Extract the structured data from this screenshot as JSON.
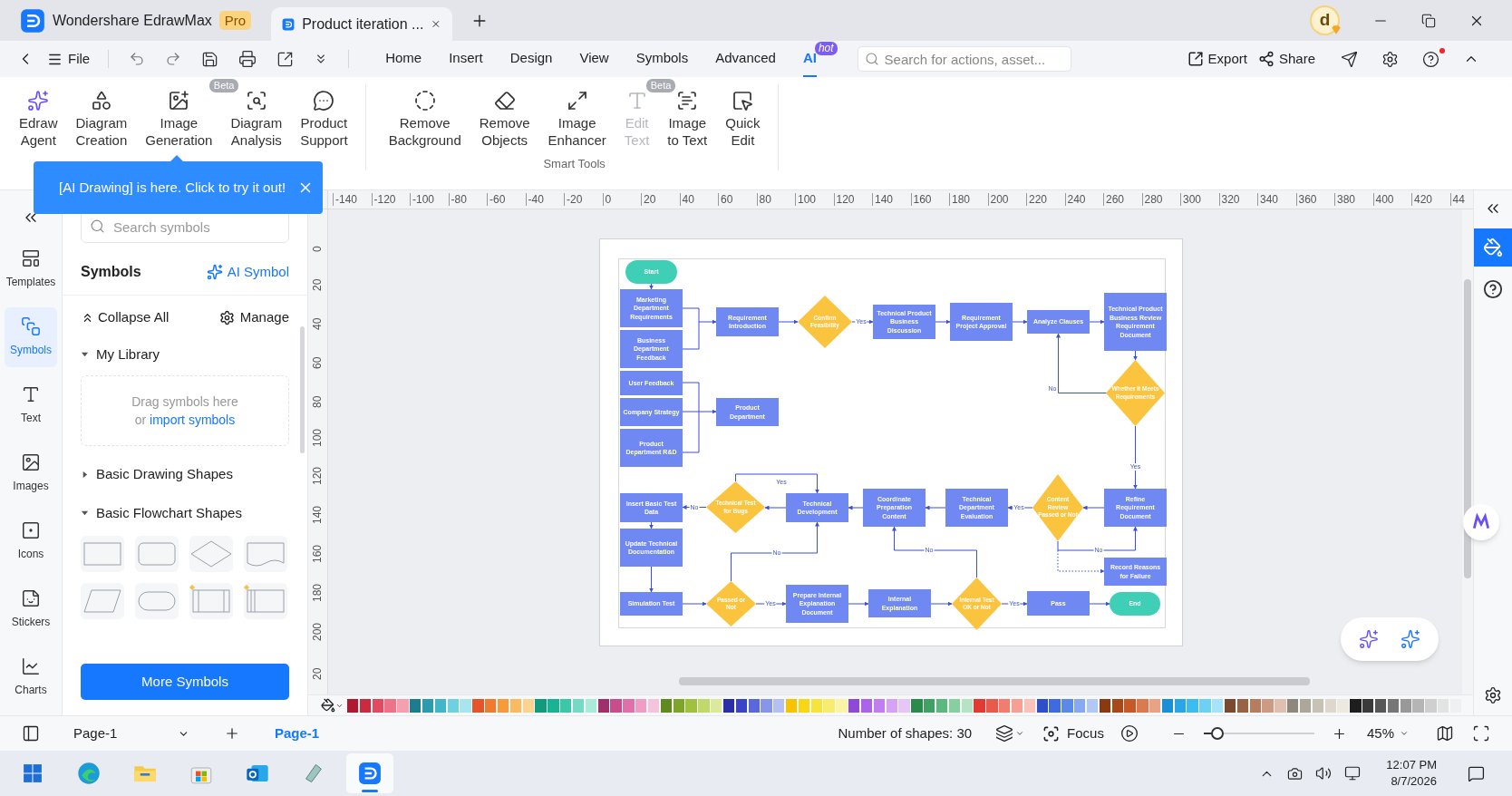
{
  "title_bar": {
    "app_tab": {
      "label": "Wondershare EdrawMax",
      "badge": "Pro"
    },
    "doc_tab": {
      "label": "Product iteration ...",
      "selected": true
    },
    "avatar": "d"
  },
  "menu_bar": {
    "file": "File",
    "tabs": [
      {
        "label": "Home",
        "selected": false
      },
      {
        "label": "Insert",
        "selected": false
      },
      {
        "label": "Design",
        "selected": false
      },
      {
        "label": "View",
        "selected": false
      },
      {
        "label": "Symbols",
        "selected": false
      },
      {
        "label": "Advanced",
        "selected": false
      },
      {
        "label": "AI",
        "selected": true,
        "badge": "hot"
      }
    ],
    "search": {
      "placeholder": "Search for actions, asset..."
    },
    "export": "Export",
    "share": "Share"
  },
  "ribbon": {
    "groups": [
      {
        "items": [
          {
            "label": "Edraw\nAgent",
            "disabled": false
          },
          {
            "label": "Diagram\nCreation",
            "disabled": false
          },
          {
            "label": "Image\nGeneration",
            "disabled": false,
            "badge": "Beta"
          },
          {
            "label": "Diagram\nAnalysis",
            "disabled": false
          },
          {
            "label": "Product\nSupport",
            "disabled": false
          }
        ]
      },
      {
        "label": "Smart Tools",
        "items": [
          {
            "label": "Remove\nBackground",
            "disabled": false
          },
          {
            "label": "Remove\nObjects",
            "disabled": false
          },
          {
            "label": "Image\nEnhancer",
            "disabled": false
          },
          {
            "label": "Edit\nText",
            "disabled": true,
            "badge": "Beta"
          },
          {
            "label": "Image\nto Text",
            "disabled": false
          },
          {
            "label": "Quick\nEdit",
            "disabled": false
          }
        ]
      }
    ]
  },
  "tip_banner": "[AI Drawing] is here. Click to try it out!",
  "left_rail": [
    {
      "label": "Templates",
      "selected": false
    },
    {
      "label": "Symbols",
      "selected": true
    },
    {
      "label": "Text",
      "selected": false
    },
    {
      "label": "Images",
      "selected": false
    },
    {
      "label": "Icons",
      "selected": false
    },
    {
      "label": "Stickers",
      "selected": false
    },
    {
      "label": "Charts",
      "selected": false
    }
  ],
  "symbols_panel": {
    "search": {
      "placeholder": "Search symbols"
    },
    "title": "Symbols",
    "ai_symbol": "AI Symbol",
    "collapse_all": "Collapse All",
    "manage": "Manage",
    "libraries": [
      {
        "name": "My Library",
        "expanded": true,
        "kind": "dropzone",
        "hint": "Drag symbols here",
        "hint_prefix": "or",
        "link": "import symbols"
      },
      {
        "name": "Basic Drawing Shapes",
        "expanded": false,
        "kind": "shapes"
      },
      {
        "name": "Basic Flowchart Shapes",
        "expanded": true,
        "kind": "shapes"
      }
    ],
    "more_button": "More Symbols"
  },
  "rulers": {
    "horizontal": [
      "-140",
      "-120",
      "-100",
      "-80",
      "-60",
      "-40",
      "-20",
      "0",
      "20",
      "40",
      "60",
      "80",
      "100",
      "120",
      "140",
      "160",
      "180",
      "200",
      "220",
      "240",
      "260",
      "280",
      "300",
      "320",
      "340",
      "360",
      "380",
      "400",
      "420",
      "44"
    ],
    "vertical": [
      "0",
      "20",
      "40",
      "60",
      "80",
      "100",
      "120",
      "140",
      "160",
      "180",
      "200",
      "20"
    ]
  },
  "diagram": {
    "nodes": [
      {
        "kind": "start",
        "text": "Start"
      },
      {
        "kind": "process",
        "text": "Marketing Department Requirements"
      },
      {
        "kind": "process",
        "text": "Requirement Introduction"
      },
      {
        "kind": "decision",
        "text": "Confirm Feasibility"
      },
      {
        "kind": "process",
        "text": "Technical Product Business Discussion"
      },
      {
        "kind": "process",
        "text": "Requirement Project Approval"
      },
      {
        "kind": "process",
        "text": "Analyze Clauses"
      },
      {
        "kind": "process",
        "text": "Technical Product Business Review Requirement Document"
      },
      {
        "kind": "process",
        "text": "Business Department Feedback"
      },
      {
        "kind": "decision",
        "text": "Whether It Meets Requirements"
      },
      {
        "kind": "process",
        "text": "User Feedback"
      },
      {
        "kind": "process",
        "text": "Company Strategy"
      },
      {
        "kind": "process",
        "text": "Product Department"
      },
      {
        "kind": "process",
        "text": "Product Department R&D"
      },
      {
        "kind": "process",
        "text": "Insert Basic Test Data"
      },
      {
        "kind": "decision",
        "text": "Technical Test for Bugs"
      },
      {
        "kind": "process",
        "text": "Technical Development"
      },
      {
        "kind": "process",
        "text": "Coordinate Preparation Content"
      },
      {
        "kind": "process",
        "text": "Technical Department Evaluation"
      },
      {
        "kind": "decision",
        "text": "Content Review Passed or Not"
      },
      {
        "kind": "process",
        "text": "Refine Requirement Document"
      },
      {
        "kind": "process",
        "text": "Update Technical Documentation"
      },
      {
        "kind": "process",
        "text": "Record Reasons for Failure"
      },
      {
        "kind": "process",
        "text": "Simulation Test"
      },
      {
        "kind": "decision",
        "text": "Passed or Not"
      },
      {
        "kind": "process",
        "text": "Prepare Internal Explanation Document"
      },
      {
        "kind": "process",
        "text": "Internal Explanation"
      },
      {
        "kind": "decision",
        "text": "Internal Test OK or Not"
      },
      {
        "kind": "process",
        "text": "Pass"
      },
      {
        "kind": "end",
        "text": "End"
      }
    ],
    "edge_labels": [
      "Yes",
      "No",
      "Yes",
      "Yes",
      "No",
      "Yes",
      "No",
      "No",
      "No",
      "Yes",
      "Yes"
    ]
  },
  "palette": {
    "swatches": [
      {
        "color": "#b0182f"
      },
      {
        "color": "#cc2a3f"
      },
      {
        "color": "#e24a60"
      },
      {
        "color": "#ee7389"
      },
      {
        "color": "#f4a0b0"
      },
      {
        "color": "#1d7d8f"
      },
      {
        "color": "#2c9bad"
      },
      {
        "color": "#40b6c8"
      },
      {
        "color": "#6fd0df"
      },
      {
        "color": "#a7e6ef"
      },
      {
        "color": "#e6552a"
      },
      {
        "color": "#f17a2e"
      },
      {
        "color": "#f79a3a"
      },
      {
        "color": "#fbb960"
      },
      {
        "color": "#fcd38f"
      },
      {
        "color": "#0f9b7e"
      },
      {
        "color": "#18b394"
      },
      {
        "color": "#3cc8a8"
      },
      {
        "color": "#74dbc2"
      },
      {
        "color": "#aaeadb"
      },
      {
        "color": "#a0306a"
      },
      {
        "color": "#c84d8a"
      },
      {
        "color": "#e071a8"
      },
      {
        "color": "#ef9dc4"
      },
      {
        "color": "#f5c3db"
      },
      {
        "color": "#5e8a1e"
      },
      {
        "color": "#7ea52a"
      },
      {
        "color": "#9fc13f"
      },
      {
        "color": "#c1d96a"
      },
      {
        "color": "#dbe99d"
      },
      {
        "color": "#2a2fa8"
      },
      {
        "color": "#3a44c8"
      },
      {
        "color": "#5a68dd"
      },
      {
        "color": "#8896ea"
      },
      {
        "color": "#b4bff2"
      },
      {
        "color": "#f7c300"
      },
      {
        "color": "#f8d614"
      },
      {
        "color": "#f6e43a"
      },
      {
        "color": "#f8ec6e"
      },
      {
        "color": "#fbf3a6"
      },
      {
        "color": "#8e4ad6"
      },
      {
        "color": "#a964e8"
      },
      {
        "color": "#c17ef0"
      },
      {
        "color": "#d6a2f5"
      },
      {
        "color": "#e6c6f9"
      },
      {
        "color": "#2a8a4a"
      },
      {
        "color": "#3fa262"
      },
      {
        "color": "#5bb97e"
      },
      {
        "color": "#88cfa0"
      },
      {
        "color": "#b6e3c4"
      },
      {
        "color": "#e03a32"
      },
      {
        "color": "#ea5a4c"
      },
      {
        "color": "#f17d6e"
      },
      {
        "color": "#f5a093"
      },
      {
        "color": "#f9c3ba"
      },
      {
        "color": "#2f4fc8"
      },
      {
        "color": "#3f6ae0"
      },
      {
        "color": "#5b89ea"
      },
      {
        "color": "#86a9f1"
      },
      {
        "color": "#b1c7f6"
      },
      {
        "color": "#8a3a0e"
      },
      {
        "color": "#a84818"
      },
      {
        "color": "#c55a26"
      },
      {
        "color": "#d97b4e"
      },
      {
        "color": "#e7a383"
      },
      {
        "color": "#1a8fd8"
      },
      {
        "color": "#2aa6e6"
      },
      {
        "color": "#3dbcf0"
      },
      {
        "color": "#6dd0f5"
      },
      {
        "color": "#a4e3f9"
      },
      {
        "color": "#7b4a2e"
      },
      {
        "color": "#9a6244"
      },
      {
        "color": "#b57d5f"
      },
      {
        "color": "#cb9c83"
      },
      {
        "color": "#dfbfae"
      },
      {
        "color": "#8e877d"
      },
      {
        "color": "#ada69b"
      },
      {
        "color": "#c8c1b5"
      },
      {
        "color": "#ddd7cc"
      },
      {
        "color": "#ede9e1"
      },
      {
        "color": "#1e1e1e"
      },
      {
        "color": "#3a3a3a"
      },
      {
        "color": "#575757"
      },
      {
        "color": "#777777"
      },
      {
        "color": "#999999"
      },
      {
        "color": "#b5b5b5"
      },
      {
        "color": "#cfcfcf"
      },
      {
        "color": "#e3e3e3"
      },
      {
        "color": "#f0f0f0"
      }
    ]
  },
  "right_rail": [
    {
      "selected": true
    },
    {
      "selected": false
    }
  ],
  "status_bar": {
    "page_select": "Page-1",
    "pages": [
      {
        "label": "Page-1",
        "selected": true
      }
    ],
    "shape_count": "Number of shapes: 30",
    "focus": "Focus",
    "zoom": {
      "level": 0.12,
      "reading": "45%"
    }
  },
  "taskbar": {
    "apps": [
      {
        "selected": false
      },
      {
        "selected": false
      },
      {
        "selected": false
      },
      {
        "selected": false
      },
      {
        "selected": false
      },
      {
        "selected": true
      }
    ],
    "time": "12:07 PM",
    "date": "8/7/2026"
  }
}
